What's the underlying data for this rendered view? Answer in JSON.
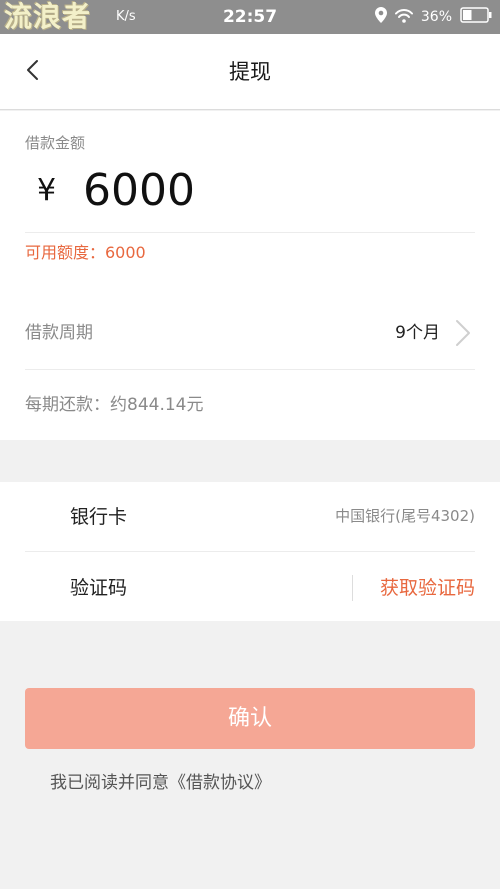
{
  "status_bar": {
    "watermark": "流浪者",
    "net_speed": "K/s",
    "time": "22:57",
    "battery": "36%",
    "icons": [
      "location-icon",
      "wifi-icon",
      "battery-icon"
    ]
  },
  "header": {
    "title": "提现",
    "back_icon": "chevron-left-icon"
  },
  "loan": {
    "amount_label": "借款金额",
    "currency": "¥",
    "amount": "6000",
    "available": "可用额度：6000",
    "period_label": "借款周期",
    "period_value": "9个月",
    "installment": "每期还款：约844.14元"
  },
  "bank": {
    "card_label": "银行卡",
    "card_value": "中国银行(尾号4302)",
    "code_label": "验证码",
    "get_code": "获取验证码"
  },
  "confirm_label": "确认",
  "agreement": "我已阅读并同意《借款协议》",
  "colors": {
    "accent": "#e8683f",
    "confirm_bg": "#f5a795",
    "page_bg": "#f1f1f1",
    "status_bar_bg": "#8e8e8e"
  }
}
